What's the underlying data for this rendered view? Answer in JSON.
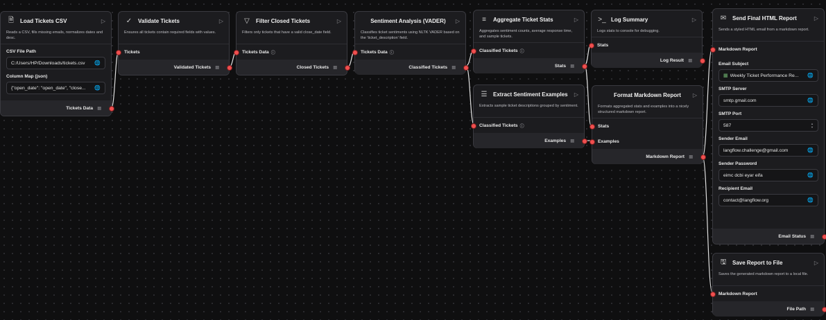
{
  "nodes": {
    "load_csv": {
      "icon": "file-icon",
      "title": "Load Tickets CSV",
      "desc": "Reads a CSV, fills missing emails, normalizes dates and desc.",
      "csv_label": "CSV File Path",
      "csv_value": "C:/Users/HP/Downloads/tickets.csv",
      "colmap_label": "Column Map (json)",
      "colmap_value": "{\"open_date\": \"open_date\", \"close...",
      "output": "Tickets Data"
    },
    "validate": {
      "title": "Validate Tickets",
      "desc": "Ensures all tickets contain required fields with values.",
      "input": "Tickets",
      "output": "Validated Tickets"
    },
    "filter": {
      "title": "Filter Closed Tickets",
      "desc": "Filters only tickets that have a valid close_date field.",
      "input": "Tickets Data",
      "output": "Closed Tickets"
    },
    "sentiment": {
      "title": "Sentiment Analysis (VADER)",
      "desc": "Classifies ticket sentiments using NLTK VADER based on the 'ticket_description' field.",
      "input": "Tickets Data",
      "output": "Classified Tickets"
    },
    "aggregate": {
      "title": "Aggregate Ticket Stats",
      "desc": "Aggregates sentiment counts, average response time, and sample tickets.",
      "input": "Classified Tickets",
      "output": "Stats"
    },
    "log": {
      "title": "Log Summary",
      "desc": "Logs stats to console for debugging.",
      "input": "Stats",
      "output": "Log Result"
    },
    "examples": {
      "title": "Extract Sentiment Examples",
      "desc": "Extracts sample ticket descriptions grouped by sentiment.",
      "input": "Classified Tickets",
      "output": "Examples"
    },
    "format": {
      "title": "Format Markdown Report",
      "desc": "Formats aggregated stats and examples into a nicely structured markdown report.",
      "input1": "Stats",
      "input2": "Examples",
      "output": "Markdown Report"
    },
    "email": {
      "title": "Send Final HTML Report",
      "desc": "Sends a styled HTML email from a markdown report.",
      "input": "Markdown Report",
      "subject_label": "Email Subject",
      "subject_value": "Weekly Ticket Performance Re...",
      "server_label": "SMTP Server",
      "server_value": "smtp.gmail.com",
      "port_label": "SMTP Port",
      "port_value": "587",
      "sender_label": "Sender Email",
      "sender_value": "langflow.challenge@gmail.com",
      "password_label": "Sender Password",
      "password_value": "eimc dcbi eyar eifa",
      "recipient_label": "Recipient Email",
      "recipient_value": "contact@langflow.org",
      "output": "Email Status"
    },
    "save": {
      "title": "Save Report to File",
      "desc": "Saves the generated markdown report to a local file.",
      "input": "Markdown Report",
      "output": "File Path"
    }
  },
  "colors": {
    "port": "#f04f4f",
    "wire": "#e8e8e8",
    "canvas": "#0f0f10",
    "node": "#1c1c1f"
  }
}
